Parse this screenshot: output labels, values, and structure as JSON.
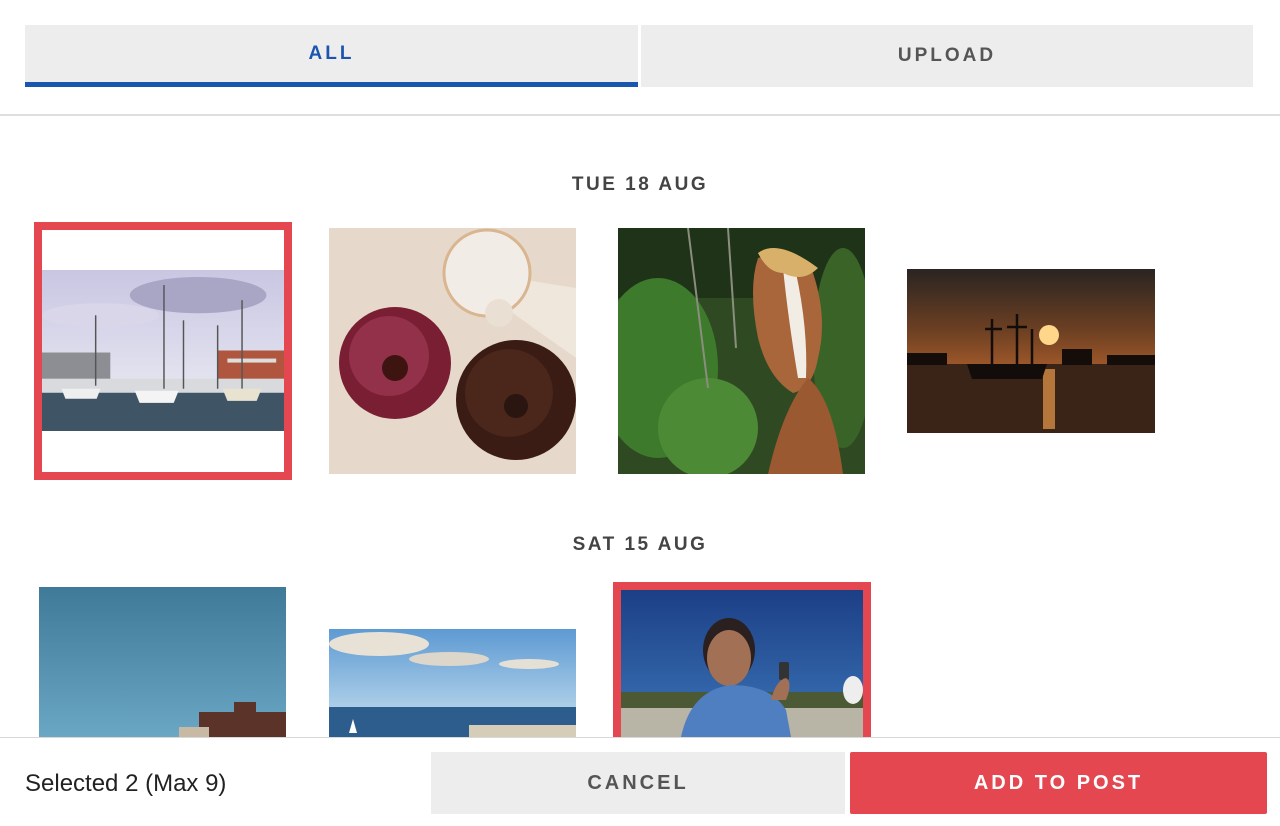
{
  "tabs": [
    {
      "label": "ALL",
      "active": true
    },
    {
      "label": "UPLOAD",
      "active": false
    }
  ],
  "groups": [
    {
      "date": "TUE 18 AUG",
      "photos": [
        {
          "subject": "marina with sailboats",
          "selected": true
        },
        {
          "subject": "donuts on paper",
          "selected": false
        },
        {
          "subject": "horse in forest",
          "selected": false
        },
        {
          "subject": "pirate ship at sunset",
          "selected": false
        }
      ]
    },
    {
      "date": "SAT 15 AUG",
      "photos": [
        {
          "subject": "brick building under blue sky",
          "selected": false
        },
        {
          "subject": "sea with sailboat and clouds",
          "selected": false
        },
        {
          "subject": "man photographing geyser",
          "selected": true
        }
      ]
    }
  ],
  "footer": {
    "selected_text": "Selected 2 (Max 9)",
    "cancel_label": "CANCEL",
    "add_label": "ADD TO POST"
  },
  "colors": {
    "accent_blue": "#1a56b0",
    "selection_red": "#e4474f",
    "tab_bg": "#ededed"
  }
}
